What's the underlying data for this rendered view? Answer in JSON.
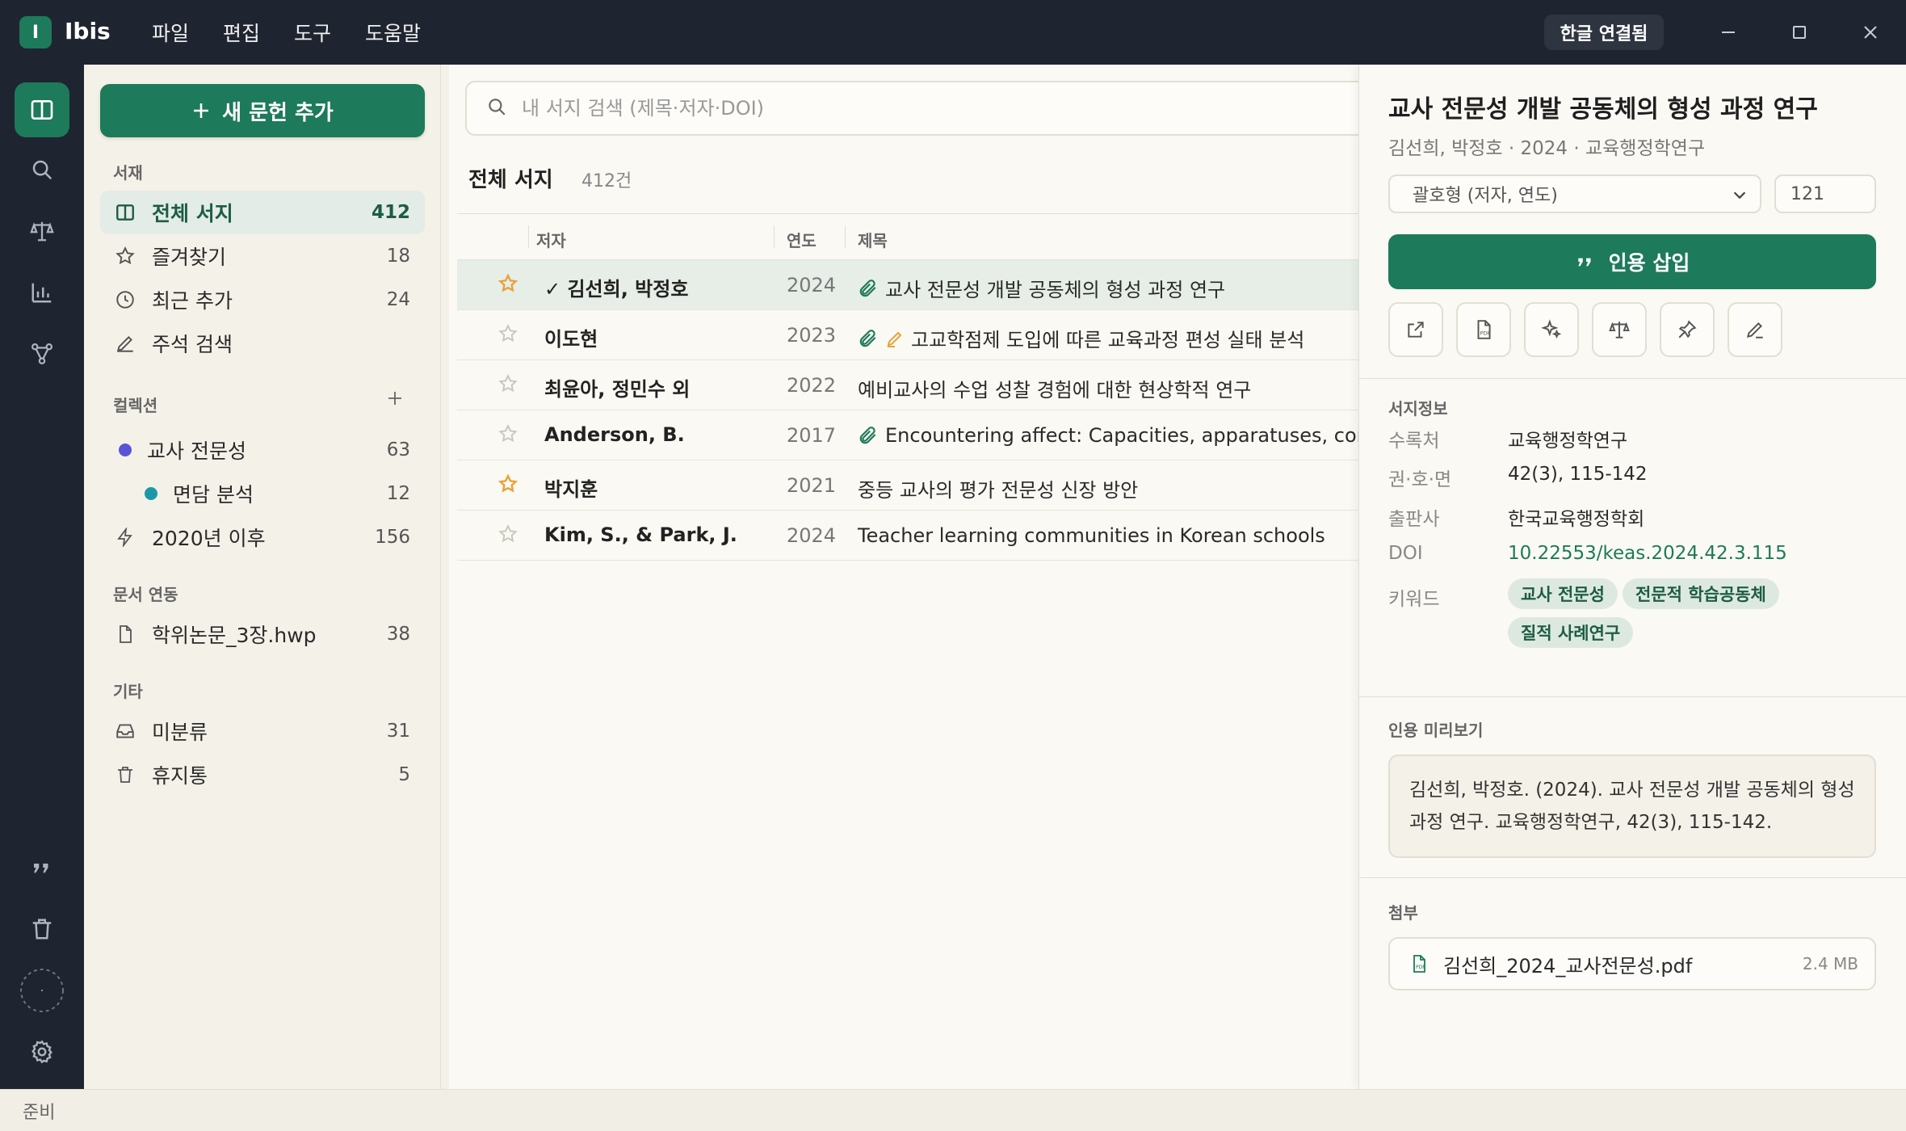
{
  "app": {
    "logo_letter": "I",
    "name": "Ibis"
  },
  "menu": [
    "파일",
    "편집",
    "도구",
    "도움말"
  ],
  "header": {
    "hangul_status": "한글 연결됨"
  },
  "sidebar": {
    "new_button": "새 문헌 추가",
    "sections": {
      "library": "서재",
      "collections": "컬렉션",
      "docs": "문서 연동",
      "other": "기타"
    },
    "library_items": [
      {
        "label": "전체 서지",
        "count": "412",
        "icon": "book-icon"
      },
      {
        "label": "즐겨찾기",
        "count": "18",
        "icon": "star-icon"
      },
      {
        "label": "최근 추가",
        "count": "24",
        "icon": "clock-icon"
      },
      {
        "label": "주석 검색",
        "count": "",
        "icon": "pen-icon"
      }
    ],
    "collections": [
      {
        "label": "교사 전문성",
        "count": "63",
        "color": "#5b53d6"
      },
      {
        "label": "면담 분석",
        "count": "12",
        "color": "#1b98a8"
      },
      {
        "label": "2020년 이후",
        "count": "156"
      }
    ],
    "docs": [
      {
        "label": "학위논문_3장.hwp",
        "count": "38"
      }
    ],
    "other": [
      {
        "label": "미분류",
        "count": "31"
      },
      {
        "label": "휴지통",
        "count": "5"
      }
    ]
  },
  "main": {
    "search_placeholder": "내 서지 검색 (제목·저자·DOI)",
    "title": "전체 서지",
    "count": "412건",
    "columns": {
      "author": "저자",
      "year": "연도",
      "title": "제목"
    },
    "rows": [
      {
        "author": "✓ 김선희, 박정호",
        "year": "2024",
        "title": "교사 전문성 개발 공동체의 형성 과정 연구",
        "starred": true,
        "attach": true,
        "note": false
      },
      {
        "author": "이도현",
        "year": "2023",
        "title": "고교학점제 도입에 따른 교육과정 편성 실태 분석",
        "starred": false,
        "attach": true,
        "note": true
      },
      {
        "author": "최윤아, 정민수 외",
        "year": "2022",
        "title": "예비교사의 수업 성찰 경험에 대한 현상학적 연구",
        "starred": false,
        "attach": false,
        "note": false
      },
      {
        "author": "Anderson, B.",
        "year": "2017",
        "title": "Encountering affect: Capacities, apparatuses, conditions",
        "starred": false,
        "attach": true,
        "note": false
      },
      {
        "author": "박지훈",
        "year": "2021",
        "title": "중등 교사의 평가 전문성 신장 방안",
        "starred": true,
        "attach": false,
        "note": false
      },
      {
        "author": "Kim, S., & Park, J.",
        "year": "2024",
        "title": "Teacher learning communities in Korean schools",
        "starred": false,
        "attach": false,
        "note": false
      }
    ]
  },
  "detail": {
    "title": "교사 전문성 개발 공동체의 형성 과정 연구",
    "subtitle": "김선희, 박정호 · 2024 · 교육행정학연구",
    "citation_style": "괄호형 (저자, 연도)",
    "page": "121",
    "insert_button": "인용 삽입",
    "bib_section": "서지정보",
    "fields": [
      {
        "key": "수록처",
        "value": "교육행정학연구"
      },
      {
        "key": "권·호·면",
        "value": "42(3), 115-142"
      },
      {
        "key": "출판사",
        "value": "한국교육행정학회"
      },
      {
        "key": "DOI",
        "value": "10.22553/keas.2024.42.3.115"
      }
    ],
    "keyword_label": "키워드",
    "keywords": [
      "교사 전문성",
      "전문적 학습공동체",
      "질적 사례연구"
    ],
    "preview_section": "인용 미리보기",
    "preview_line1": "김선희, 박정호. (2024). 교사 전문성 개발 공동체의 형성",
    "preview_line2": "과정 연구. 교육행정학연구, 42(3), 115-142.",
    "attach_section": "첨부",
    "attachment": {
      "name": "김선희_2024_교사전문성.pdf",
      "size": "2.4 MB"
    }
  },
  "status": "준비",
  "colors": {
    "accent": "#1d7a5a",
    "chrome": "#1f2530",
    "star": "#e8a23a"
  }
}
